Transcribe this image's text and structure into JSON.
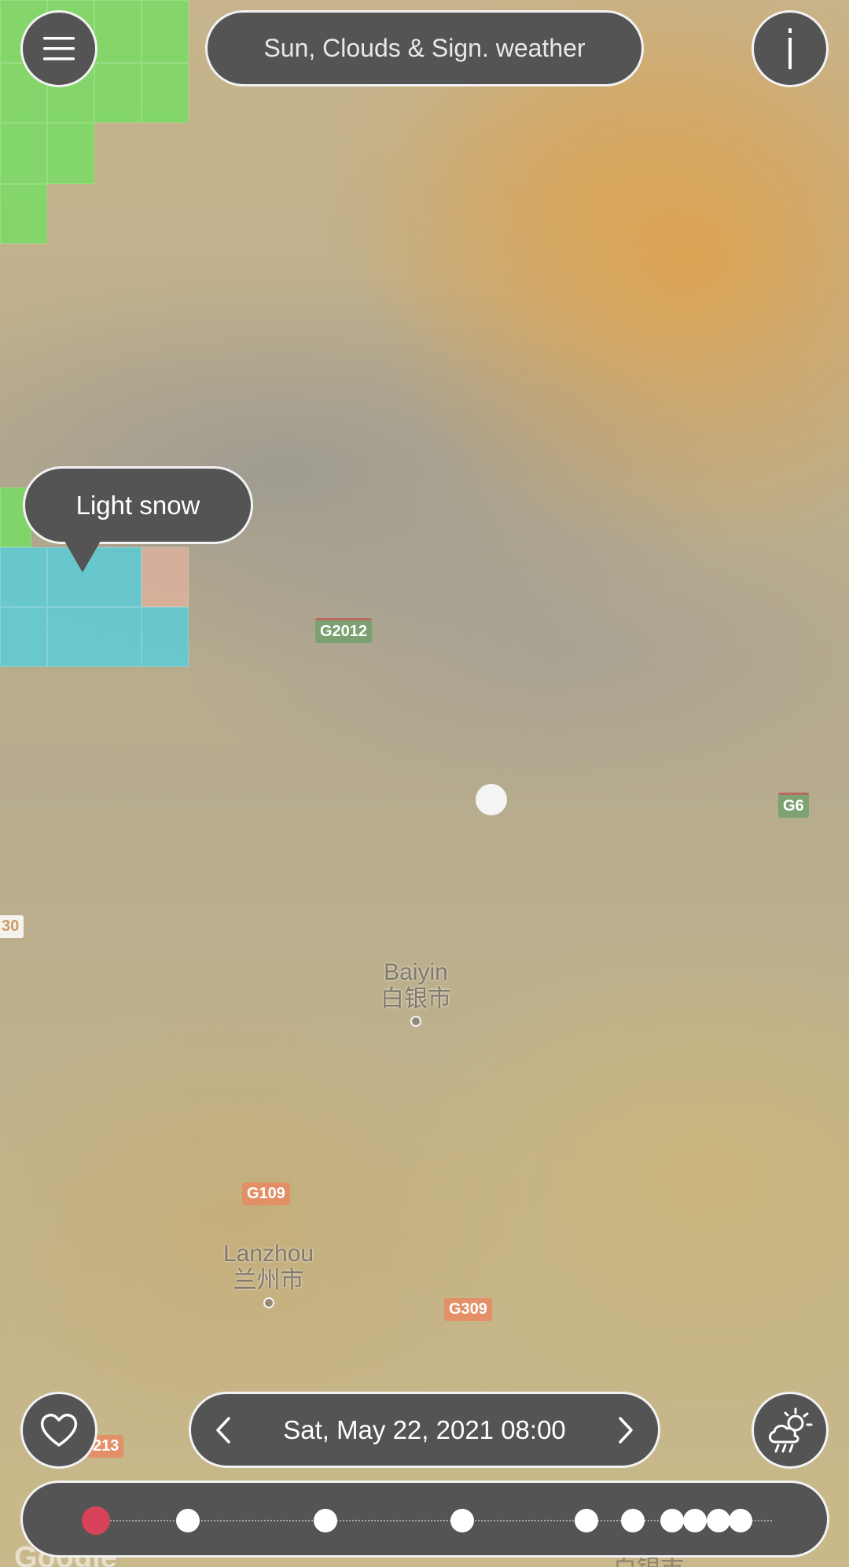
{
  "header": {
    "menu_icon": "hamburger-menu-icon",
    "layer_title": "Sun, Clouds & Sign. weather",
    "info_icon": "info-icon"
  },
  "tooltip": {
    "text": "Light snow"
  },
  "map": {
    "cities": [
      {
        "name_en": "Baiyin",
        "name_zh": "白银市"
      },
      {
        "name_en": "Lanzhou",
        "name_zh": "兰州市"
      }
    ],
    "roads": [
      "G2012",
      "G6",
      "30",
      "G109",
      "G309",
      "213"
    ],
    "partial_bottom_label": "白银市"
  },
  "footer": {
    "favorite_icon": "heart-icon",
    "date_label": "Sat, May 22, 2021 08:00",
    "prev_icon": "chevron-left-icon",
    "next_icon": "chevron-right-icon",
    "weather_icon": "sun-cloud-rain-icon",
    "timeline_points": 11,
    "timeline_active_index": 0
  },
  "attribution": "Google",
  "colors": {
    "button_bg": "#545454",
    "button_border": "#f2f2f2",
    "timeline_active": "#d9435a",
    "snow_cell": "#5acdd7",
    "rain_cell": "#78dc64"
  }
}
